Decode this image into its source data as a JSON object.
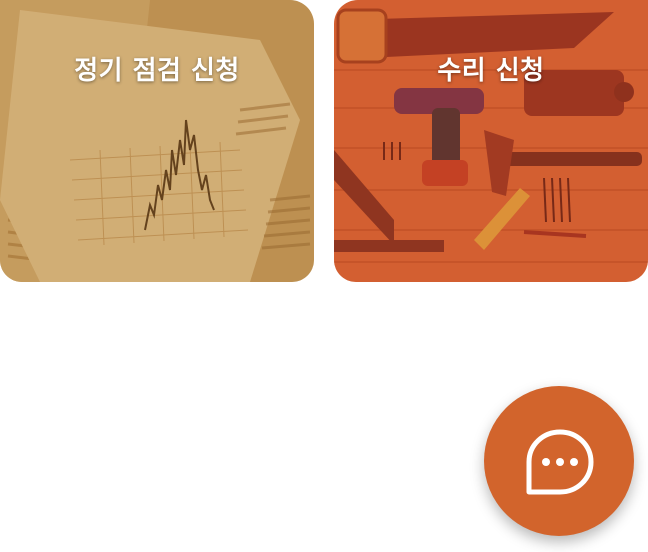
{
  "cards": [
    {
      "label": "정기 점검 신청",
      "image": "financial-newspaper-chart"
    },
    {
      "label": "수리 신청",
      "image": "tools-on-wood"
    }
  ],
  "chat_button": {
    "icon": "chat-bubble-icon"
  },
  "colors": {
    "accent": "#d2642c",
    "inspection_tint": "#c98a3c",
    "repair_tint": "#d0562c",
    "background": "#ffffff"
  }
}
